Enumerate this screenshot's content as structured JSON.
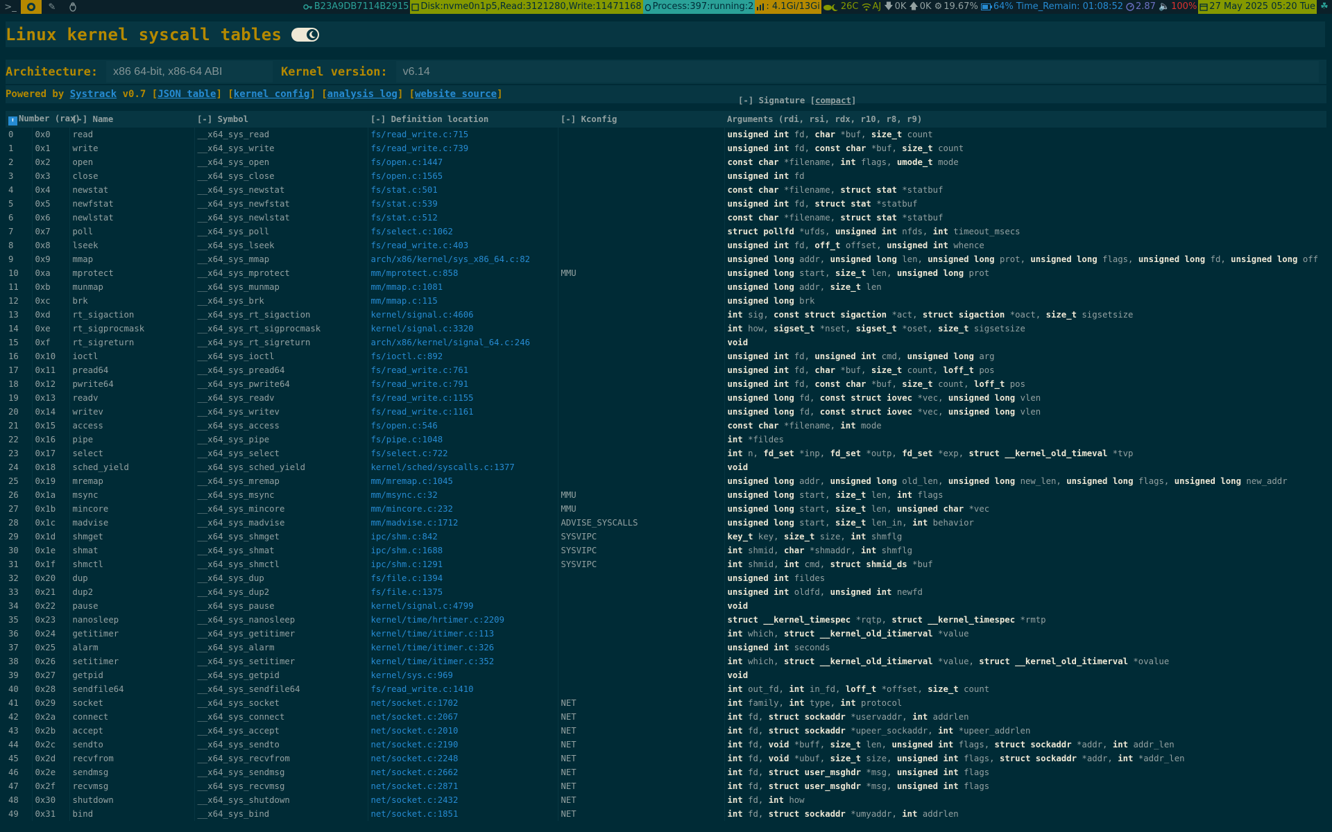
{
  "statusbar": {
    "workspaces": [
      ">_",
      "●",
      "✎",
      "🐧"
    ],
    "host_id": "B23A9DB7114B2915",
    "disk": "Disk:nvme0n1p5,Read:3121280,Write:11471168",
    "process": "Process:397:running:2",
    "memory": ": 4.1Gi/13Gi",
    "weather": "26C",
    "wifi": "AJ",
    "net_down": "0K",
    "net_up": "0K",
    "cpu": "19.67%",
    "battery": "64% Time_Remain: 01:08:52",
    "load": "2.87",
    "volume": "100%",
    "datetime": "27 May 2025 05:20 Tue"
  },
  "page": {
    "title": "Linux kernel syscall tables",
    "arch_label": "Architecture:",
    "arch_value": "x86 64-bit, x86-64 ABI",
    "kernel_label": "Kernel version:",
    "kernel_value": "v6.14",
    "powered_prefix": "Powered by",
    "systrack": "Systrack",
    "version": "v0.7",
    "links": [
      "JSON table",
      "kernel config",
      "analysis log",
      "website source"
    ],
    "sig_header_prefix": "[-] Signature [",
    "sig_header_link": "compact",
    "sig_header_suffix": "]"
  },
  "table": {
    "headers": [
      "Number (rax)",
      "[-] Name",
      "[-] Symbol",
      "[-] Definition location",
      "[-] Kconfig",
      "Arguments (rdi, rsi, rdx, r10, r8, r9)"
    ],
    "rows": [
      [
        "0",
        "0x0",
        "read",
        "__x64_sys_read",
        "fs/read_write.c:715",
        "",
        "**unsigned** **int** fd, **char** *buf, **size_t** count"
      ],
      [
        "1",
        "0x1",
        "write",
        "__x64_sys_write",
        "fs/read_write.c:739",
        "",
        "**unsigned** **int** fd, **const** **char** *buf, **size_t** count"
      ],
      [
        "2",
        "0x2",
        "open",
        "__x64_sys_open",
        "fs/open.c:1447",
        "",
        "**const** **char** *filename, **int** flags, **umode_t** mode"
      ],
      [
        "3",
        "0x3",
        "close",
        "__x64_sys_close",
        "fs/open.c:1565",
        "",
        "**unsigned** **int** fd"
      ],
      [
        "4",
        "0x4",
        "newstat",
        "__x64_sys_newstat",
        "fs/stat.c:501",
        "",
        "**const** **char** *filename, **struct** **stat** *statbuf"
      ],
      [
        "5",
        "0x5",
        "newfstat",
        "__x64_sys_newfstat",
        "fs/stat.c:539",
        "",
        "**unsigned** **int** fd, **struct** **stat** *statbuf"
      ],
      [
        "6",
        "0x6",
        "newlstat",
        "__x64_sys_newlstat",
        "fs/stat.c:512",
        "",
        "**const** **char** *filename, **struct** **stat** *statbuf"
      ],
      [
        "7",
        "0x7",
        "poll",
        "__x64_sys_poll",
        "fs/select.c:1062",
        "",
        "**struct** **pollfd** *ufds, **unsigned** **int** nfds, **int** timeout_msecs"
      ],
      [
        "8",
        "0x8",
        "lseek",
        "__x64_sys_lseek",
        "fs/read_write.c:403",
        "",
        "**unsigned** **int** fd, **off_t** offset, **unsigned** **int** whence"
      ],
      [
        "9",
        "0x9",
        "mmap",
        "__x64_sys_mmap",
        "arch/x86/kernel/sys_x86_64.c:82",
        "",
        "**unsigned** **long** addr, **unsigned** **long** len, **unsigned** **long** prot, **unsigned** **long** flags, **unsigned** **long** fd, **unsigned** **long** off"
      ],
      [
        "10",
        "0xa",
        "mprotect",
        "__x64_sys_mprotect",
        "mm/mprotect.c:858",
        "MMU",
        "**unsigned** **long** start, **size_t** len, **unsigned** **long** prot"
      ],
      [
        "11",
        "0xb",
        "munmap",
        "__x64_sys_munmap",
        "mm/mmap.c:1081",
        "",
        "**unsigned** **long** addr, **size_t** len"
      ],
      [
        "12",
        "0xc",
        "brk",
        "__x64_sys_brk",
        "mm/mmap.c:115",
        "",
        "**unsigned** **long** brk"
      ],
      [
        "13",
        "0xd",
        "rt_sigaction",
        "__x64_sys_rt_sigaction",
        "kernel/signal.c:4606",
        "",
        "**int** sig, **const** **struct** **sigaction** *act, **struct** **sigaction** *oact, **size_t** sigsetsize"
      ],
      [
        "14",
        "0xe",
        "rt_sigprocmask",
        "__x64_sys_rt_sigprocmask",
        "kernel/signal.c:3320",
        "",
        "**int** how, **sigset_t** *nset, **sigset_t** *oset, **size_t** sigsetsize"
      ],
      [
        "15",
        "0xf",
        "rt_sigreturn",
        "__x64_sys_rt_sigreturn",
        "arch/x86/kernel/signal_64.c:246",
        "",
        "**void**"
      ],
      [
        "16",
        "0x10",
        "ioctl",
        "__x64_sys_ioctl",
        "fs/ioctl.c:892",
        "",
        "**unsigned** **int** fd, **unsigned** **int** cmd, **unsigned** **long** arg"
      ],
      [
        "17",
        "0x11",
        "pread64",
        "__x64_sys_pread64",
        "fs/read_write.c:761",
        "",
        "**unsigned** **int** fd, **char** *buf, **size_t** count, **loff_t** pos"
      ],
      [
        "18",
        "0x12",
        "pwrite64",
        "__x64_sys_pwrite64",
        "fs/read_write.c:791",
        "",
        "**unsigned** **int** fd, **const** **char** *buf, **size_t** count, **loff_t** pos"
      ],
      [
        "19",
        "0x13",
        "readv",
        "__x64_sys_readv",
        "fs/read_write.c:1155",
        "",
        "**unsigned** **long** fd, **const** **struct** **iovec** *vec, **unsigned** **long** vlen"
      ],
      [
        "20",
        "0x14",
        "writev",
        "__x64_sys_writev",
        "fs/read_write.c:1161",
        "",
        "**unsigned** **long** fd, **const** **struct** **iovec** *vec, **unsigned** **long** vlen"
      ],
      [
        "21",
        "0x15",
        "access",
        "__x64_sys_access",
        "fs/open.c:546",
        "",
        "**const** **char** *filename, **int** mode"
      ],
      [
        "22",
        "0x16",
        "pipe",
        "__x64_sys_pipe",
        "fs/pipe.c:1048",
        "",
        "**int** *fildes"
      ],
      [
        "23",
        "0x17",
        "select",
        "__x64_sys_select",
        "fs/select.c:722",
        "",
        "**int** n, **fd_set** *inp, **fd_set** *outp, **fd_set** *exp, **struct** **__kernel_old_timeval** *tvp"
      ],
      [
        "24",
        "0x18",
        "sched_yield",
        "__x64_sys_sched_yield",
        "kernel/sched/syscalls.c:1377",
        "",
        "**void**"
      ],
      [
        "25",
        "0x19",
        "mremap",
        "__x64_sys_mremap",
        "mm/mremap.c:1045",
        "",
        "**unsigned** **long** addr, **unsigned** **long** old_len, **unsigned** **long** new_len, **unsigned** **long** flags, **unsigned** **long** new_addr"
      ],
      [
        "26",
        "0x1a",
        "msync",
        "__x64_sys_msync",
        "mm/msync.c:32",
        "MMU",
        "**unsigned** **long** start, **size_t** len, **int** flags"
      ],
      [
        "27",
        "0x1b",
        "mincore",
        "__x64_sys_mincore",
        "mm/mincore.c:232",
        "MMU",
        "**unsigned** **long** start, **size_t** len, **unsigned** **char** *vec"
      ],
      [
        "28",
        "0x1c",
        "madvise",
        "__x64_sys_madvise",
        "mm/madvise.c:1712",
        "ADVISE_SYSCALLS",
        "**unsigned** **long** start, **size_t** len_in, **int** behavior"
      ],
      [
        "29",
        "0x1d",
        "shmget",
        "__x64_sys_shmget",
        "ipc/shm.c:842",
        "SYSVIPC",
        "**key_t** key, **size_t** size, **int** shmflg"
      ],
      [
        "30",
        "0x1e",
        "shmat",
        "__x64_sys_shmat",
        "ipc/shm.c:1688",
        "SYSVIPC",
        "**int** shmid, **char** *shmaddr, **int** shmflg"
      ],
      [
        "31",
        "0x1f",
        "shmctl",
        "__x64_sys_shmctl",
        "ipc/shm.c:1291",
        "SYSVIPC",
        "**int** shmid, **int** cmd, **struct** **shmid_ds** *buf"
      ],
      [
        "32",
        "0x20",
        "dup",
        "__x64_sys_dup",
        "fs/file.c:1394",
        "",
        "**unsigned** **int** fildes"
      ],
      [
        "33",
        "0x21",
        "dup2",
        "__x64_sys_dup2",
        "fs/file.c:1375",
        "",
        "**unsigned** **int** oldfd, **unsigned** **int** newfd"
      ],
      [
        "34",
        "0x22",
        "pause",
        "__x64_sys_pause",
        "kernel/signal.c:4799",
        "",
        "**void**"
      ],
      [
        "35",
        "0x23",
        "nanosleep",
        "__x64_sys_nanosleep",
        "kernel/time/hrtimer.c:2209",
        "",
        "**struct** **__kernel_timespec** *rqtp, **struct** **__kernel_timespec** *rmtp"
      ],
      [
        "36",
        "0x24",
        "getitimer",
        "__x64_sys_getitimer",
        "kernel/time/itimer.c:113",
        "",
        "**int** which, **struct** **__kernel_old_itimerval** *value"
      ],
      [
        "37",
        "0x25",
        "alarm",
        "__x64_sys_alarm",
        "kernel/time/itimer.c:326",
        "",
        "**unsigned** **int** seconds"
      ],
      [
        "38",
        "0x26",
        "setitimer",
        "__x64_sys_setitimer",
        "kernel/time/itimer.c:352",
        "",
        "**int** which, **struct** **__kernel_old_itimerval** *value, **struct** **__kernel_old_itimerval** *ovalue"
      ],
      [
        "39",
        "0x27",
        "getpid",
        "__x64_sys_getpid",
        "kernel/sys.c:969",
        "",
        "**void**"
      ],
      [
        "40",
        "0x28",
        "sendfile64",
        "__x64_sys_sendfile64",
        "fs/read_write.c:1410",
        "",
        "**int** out_fd, **int** in_fd, **loff_t** *offset, **size_t** count"
      ],
      [
        "41",
        "0x29",
        "socket",
        "__x64_sys_socket",
        "net/socket.c:1702",
        "NET",
        "**int** family, **int** type, **int** protocol"
      ],
      [
        "42",
        "0x2a",
        "connect",
        "__x64_sys_connect",
        "net/socket.c:2067",
        "NET",
        "**int** fd, **struct** **sockaddr** *uservaddr, **int** addrlen"
      ],
      [
        "43",
        "0x2b",
        "accept",
        "__x64_sys_accept",
        "net/socket.c:2010",
        "NET",
        "**int** fd, **struct** **sockaddr** *upeer_sockaddr, **int** *upeer_addrlen"
      ],
      [
        "44",
        "0x2c",
        "sendto",
        "__x64_sys_sendto",
        "net/socket.c:2190",
        "NET",
        "**int** fd, **void** *buff, **size_t** len, **unsigned** **int** flags, **struct** **sockaddr** *addr, **int** addr_len"
      ],
      [
        "45",
        "0x2d",
        "recvfrom",
        "__x64_sys_recvfrom",
        "net/socket.c:2248",
        "NET",
        "**int** fd, **void** *ubuf, **size_t** size, **unsigned** **int** flags, **struct** **sockaddr** *addr, **int** *addr_len"
      ],
      [
        "46",
        "0x2e",
        "sendmsg",
        "__x64_sys_sendmsg",
        "net/socket.c:2662",
        "NET",
        "**int** fd, **struct** **user_msghdr** *msg, **unsigned** **int** flags"
      ],
      [
        "47",
        "0x2f",
        "recvmsg",
        "__x64_sys_recvmsg",
        "net/socket.c:2871",
        "NET",
        "**int** fd, **struct** **user_msghdr** *msg, **unsigned** **int** flags"
      ],
      [
        "48",
        "0x30",
        "shutdown",
        "__x64_sys_shutdown",
        "net/socket.c:2432",
        "NET",
        "**int** fd, **int** how"
      ],
      [
        "49",
        "0x31",
        "bind",
        "__x64_sys_bind",
        "net/socket.c:1851",
        "NET",
        "**int** fd, **struct** **sockaddr** *umyaddr, **int** addrlen"
      ]
    ]
  },
  "colors": {
    "bg": "#002b36",
    "accent": "#b58900",
    "link": "#268bd2",
    "text": "#93a1a1"
  }
}
